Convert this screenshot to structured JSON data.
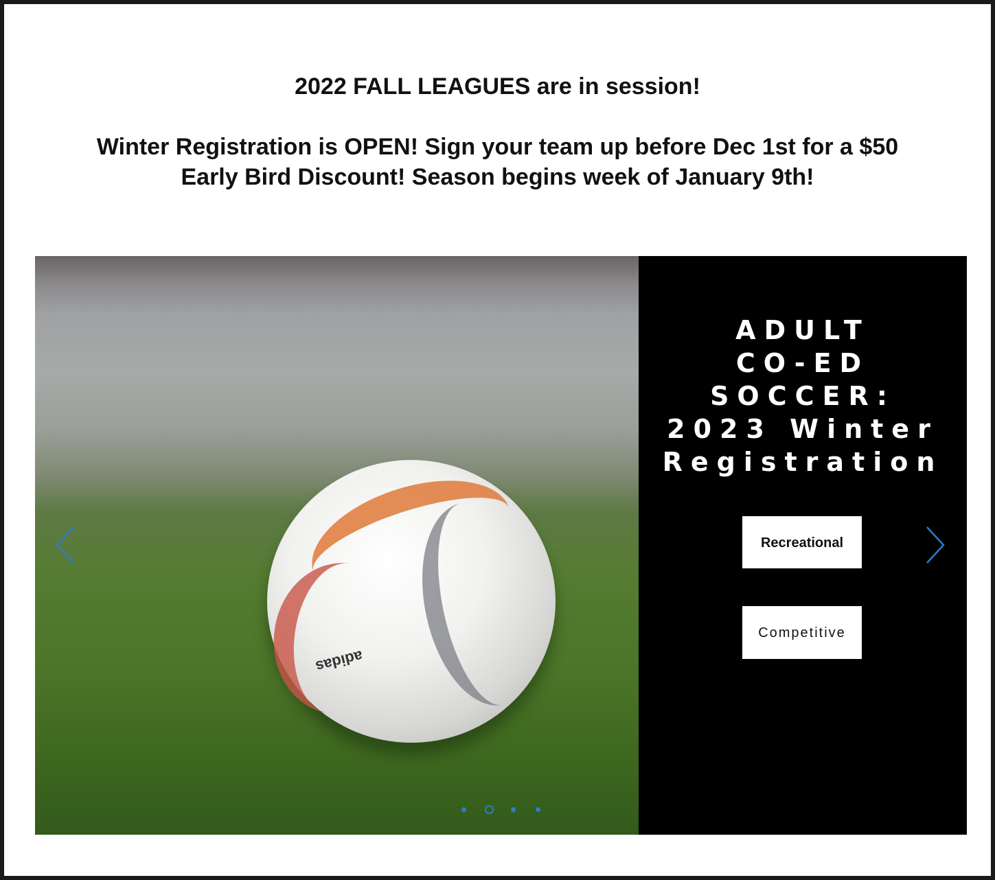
{
  "announcement": {
    "line1": "2022 FALL LEAGUES are in session!",
    "line2": "Winter Registration is OPEN! Sign your team up before Dec 1st for a $50 Early Bird Discount! Season begins week of January 9th!"
  },
  "slide": {
    "title_lines": [
      "ADULT",
      "CO-ED",
      "SOCCER:",
      "2023 Winter",
      "Registration"
    ],
    "ball_brand": "adidas",
    "buttons": {
      "recreational": "Recreational",
      "competitive": "Competitive"
    }
  },
  "slider": {
    "dot_count": 4,
    "active_dot": 1,
    "accent_color": "#2b7fc7"
  },
  "icons": {
    "prev": "chevron-left-icon",
    "next": "chevron-right-icon"
  }
}
